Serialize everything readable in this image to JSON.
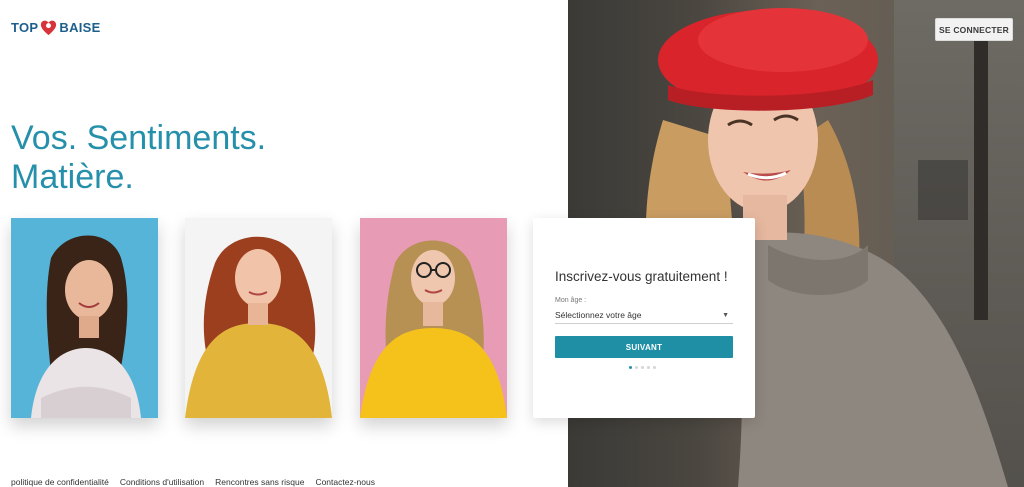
{
  "logo": {
    "left_text": "TOP",
    "right_text": "BAISE"
  },
  "header": {
    "connect_label": "SE CONNECTER"
  },
  "headline": {
    "line1": "Vos. Sentiments.",
    "line2": "Matière."
  },
  "signup": {
    "title": "Inscrivez-vous gratuitement !",
    "age_label": "Mon âge :",
    "age_select_value": "Sélectionnez votre âge",
    "next_label": "SUIVANT",
    "step_count": 5,
    "current_step": 1
  },
  "footer": {
    "links": [
      "politique de confidentialité",
      "Conditions d'utilisation",
      "Rencontres sans risque",
      "Contactez-nous"
    ]
  },
  "colors": {
    "brand_teal": "#2690ab",
    "button_teal": "#1f8fa6",
    "logo_blue": "#1d5f8c",
    "logo_red": "#d6333a",
    "card1_bg": "#57b4d9",
    "card2_bg": "#f4f4f4",
    "card3_bg": "#e79bb4",
    "beret_red": "#d9242b"
  }
}
